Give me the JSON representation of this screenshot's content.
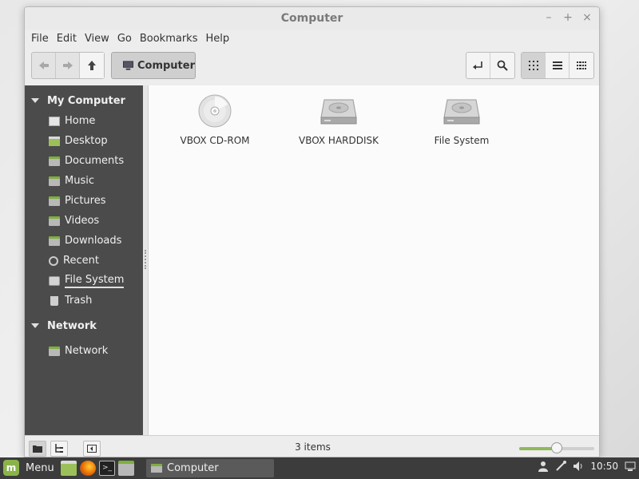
{
  "window": {
    "title": "Computer"
  },
  "window_controls": {
    "minimize": "–",
    "maximize": "+",
    "close": "×"
  },
  "menubar": [
    "File",
    "Edit",
    "View",
    "Go",
    "Bookmarks",
    "Help"
  ],
  "toolbar": {
    "path_button": "Computer"
  },
  "sidebar": {
    "sections": [
      {
        "title": "My Computer",
        "items": [
          {
            "label": "Home",
            "icon": "home-icon"
          },
          {
            "label": "Desktop",
            "icon": "desktop-icon"
          },
          {
            "label": "Documents",
            "icon": "folder-icon"
          },
          {
            "label": "Music",
            "icon": "folder-icon"
          },
          {
            "label": "Pictures",
            "icon": "folder-icon"
          },
          {
            "label": "Videos",
            "icon": "folder-icon"
          },
          {
            "label": "Downloads",
            "icon": "folder-icon"
          },
          {
            "label": "Recent",
            "icon": "recent-icon"
          },
          {
            "label": "File System",
            "icon": "drive-icon"
          },
          {
            "label": "Trash",
            "icon": "trash-icon"
          }
        ]
      },
      {
        "title": "Network",
        "items": [
          {
            "label": "Network",
            "icon": "network-icon"
          }
        ]
      }
    ]
  },
  "files": [
    {
      "label": "VBOX CD-ROM",
      "icon": "cdrom-icon"
    },
    {
      "label": "VBOX HARDDISK",
      "icon": "harddisk-icon"
    },
    {
      "label": "File System",
      "icon": "harddisk-icon"
    }
  ],
  "statusbar": {
    "items_count": "3 items",
    "zoom_fraction": 0.5
  },
  "taskbar": {
    "menu_label": "Menu",
    "window_label": "Computer",
    "clock": "10:50"
  },
  "colors": {
    "accent": "#8ab44a",
    "sidebar_bg": "#4b4b4b",
    "taskbar_bg": "#3c3c3c"
  }
}
